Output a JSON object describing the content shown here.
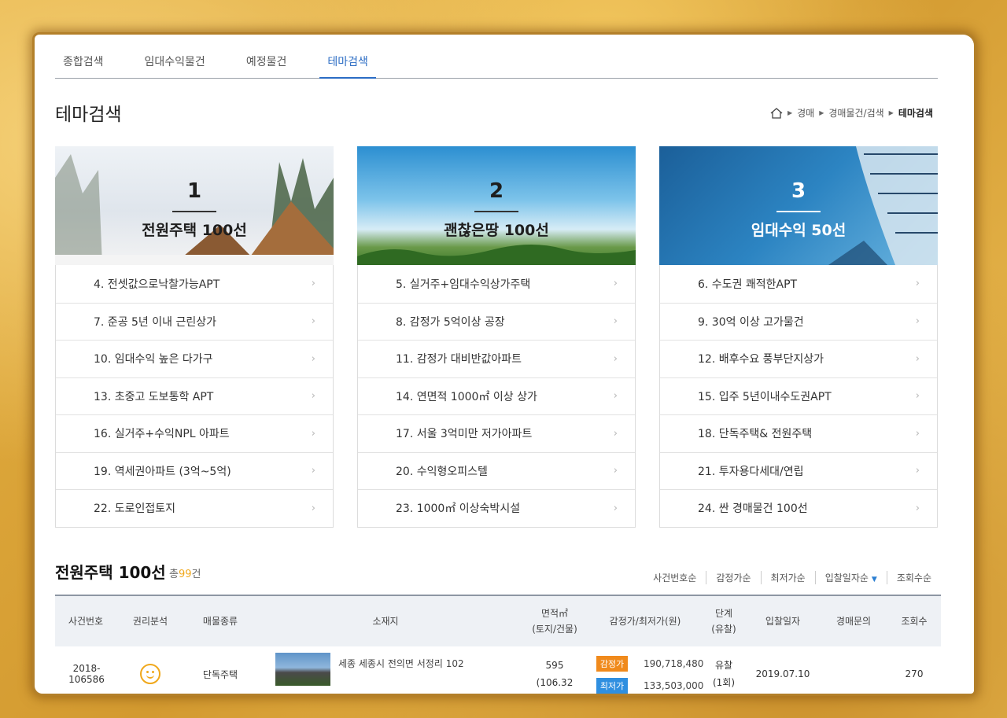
{
  "tabs": [
    {
      "label": "종합검색"
    },
    {
      "label": "임대수익물건"
    },
    {
      "label": "예정물건"
    },
    {
      "label": "테마검색"
    }
  ],
  "page_title": "테마검색",
  "breadcrumb": [
    "경매",
    "경매물건/검색",
    "테마검색"
  ],
  "cards": [
    {
      "num": "1",
      "name": "전원주택 100선",
      "items": [
        "4. 전셋값으로낙찰가능APT",
        "7. 준공 5년 이내 근린상가",
        "10. 임대수익 높은 다가구",
        "13. 초중고 도보통학 APT",
        "16. 실거주+수익NPL 아파트",
        "19. 역세권아파트 (3억~5억)",
        "22. 도로인접토지"
      ]
    },
    {
      "num": "2",
      "name": "괜찮은땅 100선",
      "items": [
        "5. 실거주+임대수익상가주택",
        "8. 감정가 5억이상 공장",
        "11. 감정가 대비반값아파트",
        "14. 연면적 1000㎡ 이상 상가",
        "17. 서울 3억미만 저가아파트",
        "20. 수익형오피스텔",
        "23. 1000㎡ 이상숙박시설"
      ]
    },
    {
      "num": "3",
      "name": "임대수익 50선",
      "items": [
        "6. 수도권 쾌적한APT",
        "9. 30억 이상 고가물건",
        "12. 배후수요 풍부단지상가",
        "15. 입주 5년이내수도권APT",
        "18. 단독주택& 전원주택",
        "21. 투자용다세대/연립",
        "24. 싼 경매물건 100선"
      ]
    }
  ],
  "list": {
    "title": "전원주택 100선",
    "count_prefix": "총",
    "count": "99",
    "count_suffix": "건",
    "sorts": [
      "사건번호순",
      "감정가순",
      "최저가순",
      "입찰일자순",
      "조회수순"
    ],
    "headers": {
      "case": "사건번호",
      "rights": "권리분석",
      "type": "매물종류",
      "location": "소재지",
      "area": "면적㎡\n(토지/건물)",
      "price": "감정가/최저가(원)",
      "stage": "단계\n(유찰)",
      "date": "입찰일자",
      "inquiry": "경매문의",
      "views": "조회수"
    },
    "rows": [
      {
        "case": "2018-106586",
        "type": "단독주택",
        "location": "세종 세종시 전의면 서정리 102",
        "area_land": "595",
        "area_building": "(106.32",
        "badge_appraisal": "감정가",
        "appraisal": "190,718,480",
        "badge_min": "최저가",
        "min": "133,503,000",
        "stage": "유찰",
        "stage_count": "(1회)",
        "date": "2019.07.10",
        "views": "270"
      }
    ]
  }
}
